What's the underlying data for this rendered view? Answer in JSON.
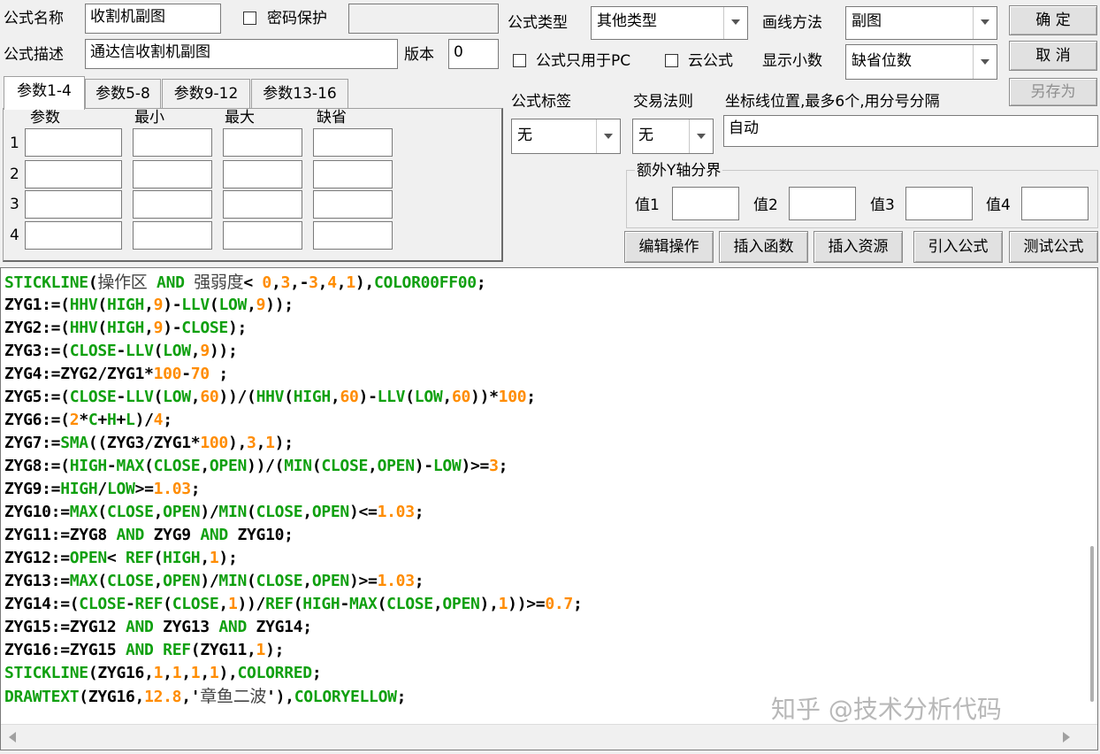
{
  "header": {
    "name_label": "公式名称",
    "name_value": "收割机副图",
    "password_label": "密码保护",
    "desc_label": "公式描述",
    "desc_value": "通达信收割机副图",
    "version_label": "版本",
    "version_value": "0",
    "type_label": "公式类型",
    "type_value": "其他类型",
    "draw_label": "画线方法",
    "draw_value": "副图",
    "pc_only_label": "公式只用于PC",
    "cloud_label": "云公式",
    "decimal_label": "显示小数",
    "decimal_value": "缺省位数"
  },
  "buttons": {
    "ok": "确  定",
    "cancel": "取  消",
    "save_as": "另存为",
    "edit_op": "编辑操作",
    "insert_func": "插入函数",
    "insert_res": "插入资源",
    "import_formula": "引入公式",
    "test_formula": "测试公式"
  },
  "tabs": [
    "参数1-4",
    "参数5-8",
    "参数9-12",
    "参数13-16"
  ],
  "param_table": {
    "headers": [
      "参数",
      "最小",
      "最大",
      "缺省"
    ],
    "rows": [
      "1",
      "2",
      "3",
      "4"
    ]
  },
  "tag": {
    "label": "公式标签",
    "value": "无"
  },
  "trade_rule": {
    "label": "交易法则",
    "value": "无"
  },
  "axis_pos": {
    "label": "坐标线位置,最多6个,用分号分隔",
    "value": "自动"
  },
  "extra_y": {
    "label": "额外Y轴分界",
    "values": [
      "值1",
      "值2",
      "值3",
      "值4"
    ]
  },
  "code_lines": [
    [
      [
        "f",
        "STICKLINE"
      ],
      [
        "k",
        "("
      ],
      [
        "cn",
        "操作区"
      ],
      [
        "k",
        " "
      ],
      [
        "f",
        "AND"
      ],
      [
        "k",
        " "
      ],
      [
        "cn",
        "强弱度"
      ],
      [
        "k",
        "< "
      ],
      [
        "n",
        "0"
      ],
      [
        "k",
        ","
      ],
      [
        "n",
        "3"
      ],
      [
        "k",
        ",-"
      ],
      [
        "n",
        "3"
      ],
      [
        "k",
        ","
      ],
      [
        "n",
        "4"
      ],
      [
        "k",
        ","
      ],
      [
        "n",
        "1"
      ],
      [
        "k",
        "),"
      ],
      [
        "f",
        "COLOR00FF00"
      ],
      [
        "k",
        ";"
      ]
    ],
    [
      [
        "k",
        "ZYG1:=("
      ],
      [
        "f",
        "HHV"
      ],
      [
        "k",
        "("
      ],
      [
        "f",
        "HIGH"
      ],
      [
        "k",
        ","
      ],
      [
        "n",
        "9"
      ],
      [
        "k",
        ")-"
      ],
      [
        "f",
        "LLV"
      ],
      [
        "k",
        "("
      ],
      [
        "f",
        "LOW"
      ],
      [
        "k",
        ","
      ],
      [
        "n",
        "9"
      ],
      [
        "k",
        "));"
      ]
    ],
    [
      [
        "k",
        "ZYG2:=("
      ],
      [
        "f",
        "HHV"
      ],
      [
        "k",
        "("
      ],
      [
        "f",
        "HIGH"
      ],
      [
        "k",
        ","
      ],
      [
        "n",
        "9"
      ],
      [
        "k",
        ")-"
      ],
      [
        "f",
        "CLOSE"
      ],
      [
        "k",
        ");"
      ]
    ],
    [
      [
        "k",
        "ZYG3:=("
      ],
      [
        "f",
        "CLOSE"
      ],
      [
        "k",
        "-"
      ],
      [
        "f",
        "LLV"
      ],
      [
        "k",
        "("
      ],
      [
        "f",
        "LOW"
      ],
      [
        "k",
        ","
      ],
      [
        "n",
        "9"
      ],
      [
        "k",
        "));"
      ]
    ],
    [
      [
        "k",
        "ZYG4:=ZYG2/ZYG1*"
      ],
      [
        "n",
        "100"
      ],
      [
        "k",
        "-"
      ],
      [
        "n",
        "70"
      ],
      [
        "k",
        " ;"
      ]
    ],
    [
      [
        "k",
        "ZYG5:=("
      ],
      [
        "f",
        "CLOSE"
      ],
      [
        "k",
        "-"
      ],
      [
        "f",
        "LLV"
      ],
      [
        "k",
        "("
      ],
      [
        "f",
        "LOW"
      ],
      [
        "k",
        ","
      ],
      [
        "n",
        "60"
      ],
      [
        "k",
        "))/("
      ],
      [
        "f",
        "HHV"
      ],
      [
        "k",
        "("
      ],
      [
        "f",
        "HIGH"
      ],
      [
        "k",
        ","
      ],
      [
        "n",
        "60"
      ],
      [
        "k",
        ")-"
      ],
      [
        "f",
        "LLV"
      ],
      [
        "k",
        "("
      ],
      [
        "f",
        "LOW"
      ],
      [
        "k",
        ","
      ],
      [
        "n",
        "60"
      ],
      [
        "k",
        "))*"
      ],
      [
        "n",
        "100"
      ],
      [
        "k",
        ";"
      ]
    ],
    [
      [
        "k",
        "ZYG6:=("
      ],
      [
        "n",
        "2"
      ],
      [
        "k",
        "*"
      ],
      [
        "f",
        "C"
      ],
      [
        "k",
        "+"
      ],
      [
        "f",
        "H"
      ],
      [
        "k",
        "+"
      ],
      [
        "f",
        "L"
      ],
      [
        "k",
        ")/"
      ],
      [
        "n",
        "4"
      ],
      [
        "k",
        ";"
      ]
    ],
    [
      [
        "k",
        "ZYG7:="
      ],
      [
        "f",
        "SMA"
      ],
      [
        "k",
        "((ZYG3/ZYG1*"
      ],
      [
        "n",
        "100"
      ],
      [
        "k",
        "),"
      ],
      [
        "n",
        "3"
      ],
      [
        "k",
        ","
      ],
      [
        "n",
        "1"
      ],
      [
        "k",
        ");"
      ]
    ],
    [
      [
        "k",
        "ZYG8:=("
      ],
      [
        "f",
        "HIGH"
      ],
      [
        "k",
        "-"
      ],
      [
        "f",
        "MAX"
      ],
      [
        "k",
        "("
      ],
      [
        "f",
        "CLOSE"
      ],
      [
        "k",
        ","
      ],
      [
        "f",
        "OPEN"
      ],
      [
        "k",
        "))/("
      ],
      [
        "f",
        "MIN"
      ],
      [
        "k",
        "("
      ],
      [
        "f",
        "CLOSE"
      ],
      [
        "k",
        ","
      ],
      [
        "f",
        "OPEN"
      ],
      [
        "k",
        ")-"
      ],
      [
        "f",
        "LOW"
      ],
      [
        "k",
        ")>="
      ],
      [
        "n",
        "3"
      ],
      [
        "k",
        ";"
      ]
    ],
    [
      [
        "k",
        "ZYG9:="
      ],
      [
        "f",
        "HIGH"
      ],
      [
        "k",
        "/"
      ],
      [
        "f",
        "LOW"
      ],
      [
        "k",
        ">="
      ],
      [
        "n",
        "1.03"
      ],
      [
        "k",
        ";"
      ]
    ],
    [
      [
        "k",
        "ZYG10:="
      ],
      [
        "f",
        "MAX"
      ],
      [
        "k",
        "("
      ],
      [
        "f",
        "CLOSE"
      ],
      [
        "k",
        ","
      ],
      [
        "f",
        "OPEN"
      ],
      [
        "k",
        ")/"
      ],
      [
        "f",
        "MIN"
      ],
      [
        "k",
        "("
      ],
      [
        "f",
        "CLOSE"
      ],
      [
        "k",
        ","
      ],
      [
        "f",
        "OPEN"
      ],
      [
        "k",
        ")<="
      ],
      [
        "n",
        "1.03"
      ],
      [
        "k",
        ";"
      ]
    ],
    [
      [
        "k",
        "ZYG11:=ZYG8 "
      ],
      [
        "f",
        "AND"
      ],
      [
        "k",
        " ZYG9 "
      ],
      [
        "f",
        "AND"
      ],
      [
        "k",
        " ZYG10;"
      ]
    ],
    [
      [
        "k",
        "ZYG12:="
      ],
      [
        "f",
        "OPEN"
      ],
      [
        "k",
        "< "
      ],
      [
        "f",
        "REF"
      ],
      [
        "k",
        "("
      ],
      [
        "f",
        "HIGH"
      ],
      [
        "k",
        ","
      ],
      [
        "n",
        "1"
      ],
      [
        "k",
        ");"
      ]
    ],
    [
      [
        "k",
        "ZYG13:="
      ],
      [
        "f",
        "MAX"
      ],
      [
        "k",
        "("
      ],
      [
        "f",
        "CLOSE"
      ],
      [
        "k",
        ","
      ],
      [
        "f",
        "OPEN"
      ],
      [
        "k",
        ")/"
      ],
      [
        "f",
        "MIN"
      ],
      [
        "k",
        "("
      ],
      [
        "f",
        "CLOSE"
      ],
      [
        "k",
        ","
      ],
      [
        "f",
        "OPEN"
      ],
      [
        "k",
        ")>="
      ],
      [
        "n",
        "1.03"
      ],
      [
        "k",
        ";"
      ]
    ],
    [
      [
        "k",
        "ZYG14:=("
      ],
      [
        "f",
        "CLOSE"
      ],
      [
        "k",
        "-"
      ],
      [
        "f",
        "REF"
      ],
      [
        "k",
        "("
      ],
      [
        "f",
        "CLOSE"
      ],
      [
        "k",
        ","
      ],
      [
        "n",
        "1"
      ],
      [
        "k",
        "))/"
      ],
      [
        "f",
        "REF"
      ],
      [
        "k",
        "("
      ],
      [
        "f",
        "HIGH"
      ],
      [
        "k",
        "-"
      ],
      [
        "f",
        "MAX"
      ],
      [
        "k",
        "("
      ],
      [
        "f",
        "CLOSE"
      ],
      [
        "k",
        ","
      ],
      [
        "f",
        "OPEN"
      ],
      [
        "k",
        "),"
      ],
      [
        "n",
        "1"
      ],
      [
        "k",
        "))>="
      ],
      [
        "n",
        "0.7"
      ],
      [
        "k",
        ";"
      ]
    ],
    [
      [
        "k",
        "ZYG15:=ZYG12 "
      ],
      [
        "f",
        "AND"
      ],
      [
        "k",
        " ZYG13 "
      ],
      [
        "f",
        "AND"
      ],
      [
        "k",
        " ZYG14;"
      ]
    ],
    [
      [
        "k",
        "ZYG16:=ZYG15 "
      ],
      [
        "f",
        "AND"
      ],
      [
        "k",
        " "
      ],
      [
        "f",
        "REF"
      ],
      [
        "k",
        "(ZYG11,"
      ],
      [
        "n",
        "1"
      ],
      [
        "k",
        ");"
      ]
    ],
    [
      [
        "f",
        "STICKLINE"
      ],
      [
        "k",
        "(ZYG16,"
      ],
      [
        "n",
        "1"
      ],
      [
        "k",
        ","
      ],
      [
        "n",
        "1"
      ],
      [
        "k",
        ","
      ],
      [
        "n",
        "1"
      ],
      [
        "k",
        ","
      ],
      [
        "n",
        "1"
      ],
      [
        "k",
        "),"
      ],
      [
        "f",
        "COLORRED"
      ],
      [
        "k",
        ";"
      ]
    ],
    [
      [
        "f",
        "DRAWTEXT"
      ],
      [
        "k",
        "(ZYG16,"
      ],
      [
        "n",
        "12.8"
      ],
      [
        "k",
        ",'"
      ],
      [
        "cn",
        "章鱼二波"
      ],
      [
        "k",
        "'),"
      ],
      [
        "f",
        "COLORYELLOW"
      ],
      [
        "k",
        ";"
      ]
    ]
  ],
  "watermark": "知乎 @技术分析代码"
}
